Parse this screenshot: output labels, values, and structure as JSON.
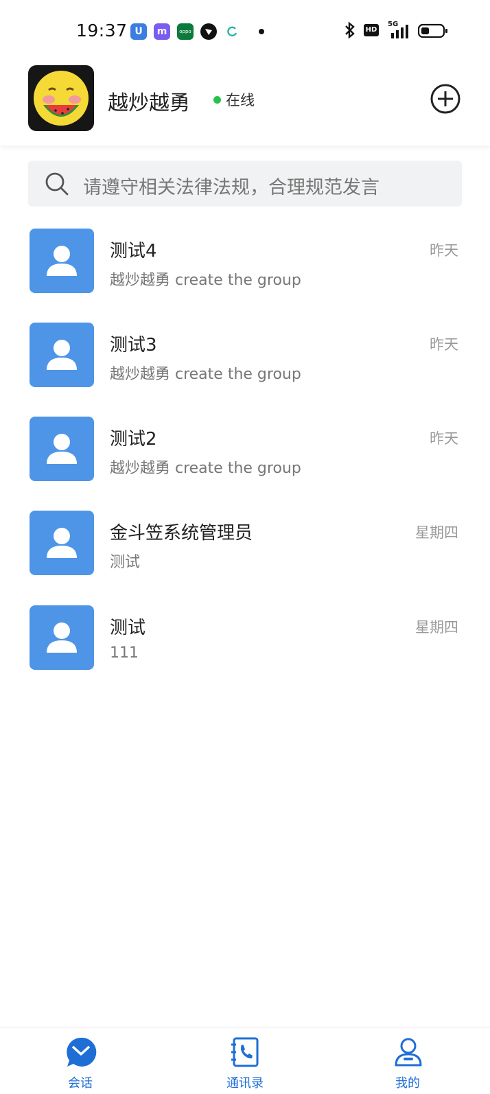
{
  "status_bar": {
    "time": "19:37",
    "app_icons": [
      "U",
      "m",
      "oppo",
      "bird-icon",
      "refresh-icon"
    ],
    "right_icons": [
      "bluetooth-icon",
      "HD",
      "5G",
      "signal-icon",
      "battery-icon"
    ]
  },
  "header": {
    "user_name": "越炒越勇",
    "status_text": "在线",
    "status_color": "#27c24c",
    "add_icon": "plus-circle-icon"
  },
  "search": {
    "placeholder": "请遵守相关法律法规，合理规范发言"
  },
  "conversations": [
    {
      "title": "测试4",
      "preview": "越炒越勇 create the group",
      "time": "昨天"
    },
    {
      "title": "测试3",
      "preview": "越炒越勇 create the group",
      "time": "昨天"
    },
    {
      "title": "测试2",
      "preview": "越炒越勇 create the group",
      "time": "昨天"
    },
    {
      "title": "金斗笠系统管理员",
      "preview": "测试",
      "time": "星期四"
    },
    {
      "title": "测试",
      "preview": "111",
      "time": "星期四"
    }
  ],
  "nav": {
    "items": [
      {
        "label": "会话",
        "icon": "chat-icon"
      },
      {
        "label": "通讯录",
        "icon": "contacts-icon"
      },
      {
        "label": "我的",
        "icon": "profile-icon"
      }
    ],
    "active_color": "#1e6ed6"
  },
  "colors": {
    "accent": "#4e95e7",
    "nav_blue": "#1e6ed6"
  }
}
